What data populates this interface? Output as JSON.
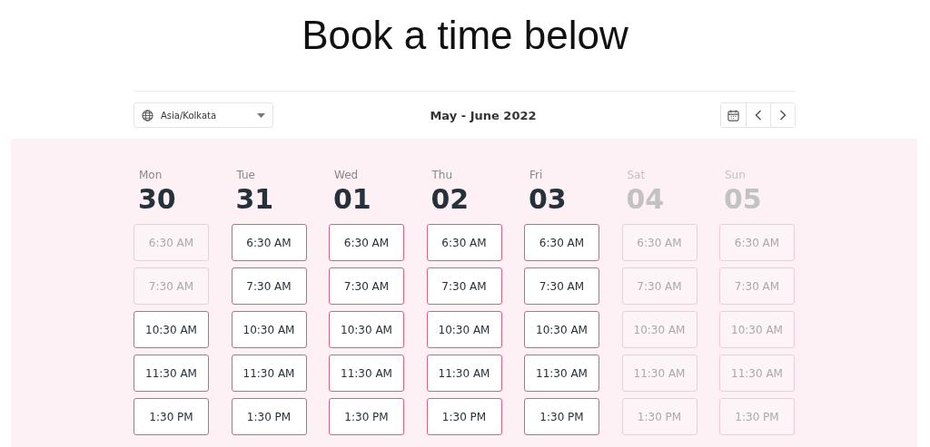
{
  "heading": "Book a time below",
  "timezone": {
    "value": "Asia/Kolkata"
  },
  "range_title": "May - June 2022",
  "days": [
    {
      "weekday": "Mon",
      "date": "30",
      "disabled": false,
      "slots": [
        {
          "time": "6:30 AM",
          "disabled": true
        },
        {
          "time": "7:30 AM",
          "disabled": true
        },
        {
          "time": "10:30 AM",
          "disabled": false
        },
        {
          "time": "11:30 AM",
          "disabled": false
        },
        {
          "time": "1:30 PM",
          "disabled": false
        }
      ]
    },
    {
      "weekday": "Tue",
      "date": "31",
      "disabled": false,
      "slots": [
        {
          "time": "6:30 AM",
          "disabled": false
        },
        {
          "time": "7:30 AM",
          "disabled": false
        },
        {
          "time": "10:30 AM",
          "disabled": false
        },
        {
          "time": "11:30 AM",
          "disabled": false
        },
        {
          "time": "1:30 PM",
          "disabled": false
        }
      ]
    },
    {
      "weekday": "Wed",
      "date": "01",
      "disabled": false,
      "slots": [
        {
          "time": "6:30 AM",
          "disabled": false
        },
        {
          "time": "7:30 AM",
          "disabled": false
        },
        {
          "time": "10:30 AM",
          "disabled": false
        },
        {
          "time": "11:30 AM",
          "disabled": false
        },
        {
          "time": "1:30 PM",
          "disabled": false
        }
      ]
    },
    {
      "weekday": "Thu",
      "date": "02",
      "disabled": false,
      "slots": [
        {
          "time": "6:30 AM",
          "disabled": false
        },
        {
          "time": "7:30 AM",
          "disabled": false
        },
        {
          "time": "10:30 AM",
          "disabled": false
        },
        {
          "time": "11:30 AM",
          "disabled": false
        },
        {
          "time": "1:30 PM",
          "disabled": false
        }
      ]
    },
    {
      "weekday": "Fri",
      "date": "03",
      "disabled": false,
      "slots": [
        {
          "time": "6:30 AM",
          "disabled": false
        },
        {
          "time": "7:30 AM",
          "disabled": false
        },
        {
          "time": "10:30 AM",
          "disabled": false
        },
        {
          "time": "11:30 AM",
          "disabled": false
        },
        {
          "time": "1:30 PM",
          "disabled": false
        }
      ]
    },
    {
      "weekday": "Sat",
      "date": "04",
      "disabled": true,
      "slots": [
        {
          "time": "6:30 AM",
          "disabled": true
        },
        {
          "time": "7:30 AM",
          "disabled": true
        },
        {
          "time": "10:30 AM",
          "disabled": true
        },
        {
          "time": "11:30 AM",
          "disabled": true
        },
        {
          "time": "1:30 PM",
          "disabled": true
        }
      ]
    },
    {
      "weekday": "Sun",
      "date": "05",
      "disabled": true,
      "slots": [
        {
          "time": "6:30 AM",
          "disabled": true
        },
        {
          "time": "7:30 AM",
          "disabled": true
        },
        {
          "time": "10:30 AM",
          "disabled": true
        },
        {
          "time": "11:30 AM",
          "disabled": true
        },
        {
          "time": "1:30 PM",
          "disabled": true
        }
      ]
    }
  ]
}
